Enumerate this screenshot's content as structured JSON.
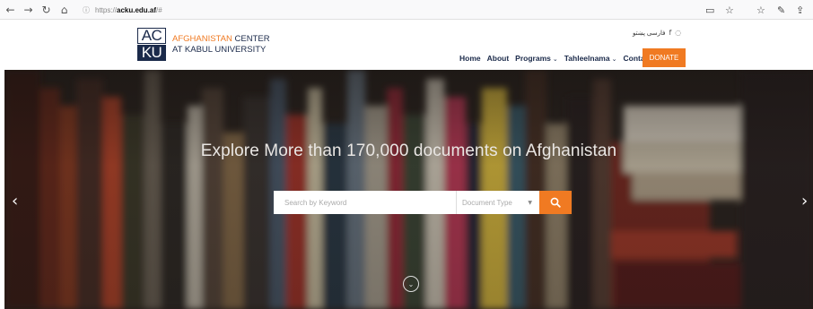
{
  "browser": {
    "url_protocol": "https://",
    "url_host": "acku.edu.af",
    "url_path": "/#",
    "back_icon": "←",
    "forward_icon": "→",
    "reload_icon": "↻",
    "home_icon": "⌂",
    "info_icon": "ⓘ",
    "reader_icon": "▭",
    "bookmark_icon": "☆",
    "favorites_icon": "☆",
    "pen_icon": "✎",
    "share_icon": "⇪"
  },
  "logo": {
    "mark_top": "AC",
    "mark_bottom": "KU",
    "line1_orange": "AFGHANISTAN",
    "line1_dark": " CENTER",
    "line2": "AT KABUL UNIVERSITY"
  },
  "lang_bar": {
    "languages": "فارسی  پښتو",
    "facebook_icon": "f",
    "rss_icon": "◌"
  },
  "menu": {
    "home": "Home",
    "about": "About",
    "programs": "Programs",
    "tahleelnama": "Tahleelnama",
    "contact": "Contact",
    "chevron": "⌄",
    "donate": "DONATE"
  },
  "hero": {
    "title": "Explore More than 170,000 documents on Afghanistan",
    "search_placeholder": "Search by Keyword",
    "doc_type": "Document Type",
    "caret": "▼",
    "search_icon": "🔍",
    "prev_arrow": "‹",
    "next_arrow": "›",
    "scroll_icon": "⌄"
  },
  "colors": {
    "accent": "#f07a22",
    "brand_dark": "#1b2a4a"
  }
}
